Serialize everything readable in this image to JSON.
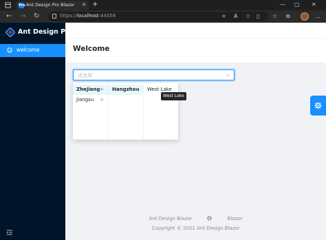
{
  "browser": {
    "tab_title": "Ant Design Pro Blazor",
    "tab_favicon_text": "Pro",
    "url_scheme": "https://",
    "url_host": "localhost",
    "url_port": ":44358",
    "new_tab_glyph": "+",
    "close_glyph": "✕"
  },
  "sidebar": {
    "brand": "Ant Design Pro",
    "items": [
      {
        "label": "welcome",
        "icon": "smile-icon",
        "active": true
      }
    ],
    "bg_color": "#001529",
    "active_color": "#1890ff"
  },
  "page": {
    "title": "Welcome"
  },
  "cascader": {
    "placeholder": "请选择",
    "columns": [
      [
        {
          "label": "Zhejiang",
          "active": true,
          "has_children": true
        },
        {
          "label": "Jiangsu",
          "active": false,
          "has_children": true
        }
      ],
      [
        {
          "label": "Hangzhou",
          "active": true,
          "has_children": true
        }
      ],
      [
        {
          "label": "West Lake",
          "active": false,
          "has_children": false
        }
      ]
    ],
    "tooltip": "West Lake",
    "arrow_glyph": ">"
  },
  "footer": {
    "links": [
      "Ant Design Blazor",
      "Blazor"
    ],
    "github_icon": "github-icon",
    "copyright": "Copyright © 2021 Ant Design Blazor"
  }
}
